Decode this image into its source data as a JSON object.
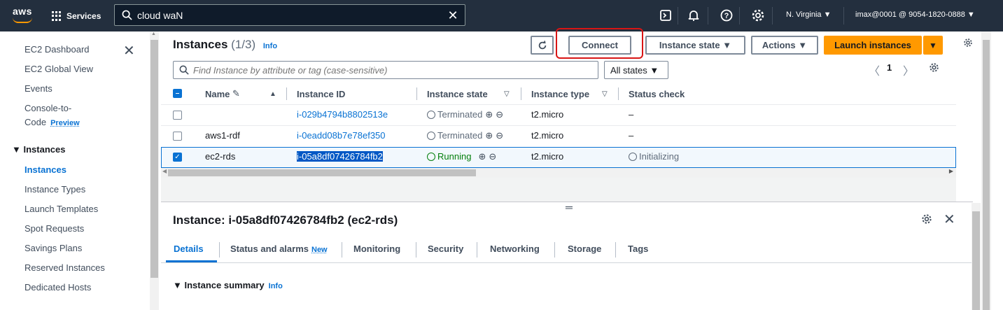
{
  "topbar": {
    "logo": "aws",
    "services": "Services",
    "search_value": "cloud waN",
    "region": "N. Virginia ▼",
    "account": "imax@0001 @ 9054-1820-0888 ▼",
    "icons": [
      "cloudshell-icon",
      "notifications-icon",
      "help-icon",
      "settings-icon"
    ]
  },
  "sidebar": {
    "items": [
      {
        "label": "EC2 Dashboard"
      },
      {
        "label": "EC2 Global View"
      },
      {
        "label": "Events"
      },
      {
        "label": "Console-to-"
      },
      {
        "label": "Code"
      },
      {
        "label": "Instances"
      },
      {
        "label": "Instance Types"
      },
      {
        "label": "Launch Templates"
      },
      {
        "label": "Spot Requests"
      },
      {
        "label": "Savings Plans"
      },
      {
        "label": "Reserved Instances"
      },
      {
        "label": "Dedicated Hosts"
      }
    ],
    "preview": "Preview",
    "section": "▼ Instances"
  },
  "header": {
    "title": "Instances",
    "count": "(1/3)",
    "info": "Info",
    "connect": "Connect",
    "instance_state": "Instance state ▼",
    "actions": "Actions ▼",
    "launch": "Launch instances",
    "launch_dropdown": "▼",
    "filter_placeholder": "Find Instance by attribute or tag (case-sensitive)",
    "states": "All states ▼",
    "page": "1"
  },
  "table": {
    "columns": [
      "Name",
      "Instance ID",
      "Instance state",
      "Instance type",
      "Status check"
    ],
    "rows": [
      {
        "name": "",
        "id": "i-029b4794b8802513e",
        "state": "Terminated",
        "type": "t2.micro",
        "status": "–"
      },
      {
        "name": "aws1-rdf",
        "id": "i-0eadd08b7e78ef350",
        "state": "Terminated",
        "type": "t2.micro",
        "status": "–"
      },
      {
        "name": "ec2-rds",
        "id": "i-05a8df07426784fb2",
        "state": "Running",
        "type": "t2.micro",
        "status": "Initializing"
      }
    ]
  },
  "detail": {
    "title": "Instance: i-05a8df07426784fb2 (ec2-rds)",
    "tabs": [
      "Details",
      "Status and alarms",
      "Monitoring",
      "Security",
      "Networking",
      "Storage",
      "Tags"
    ],
    "new_badge": "New",
    "summary": "▼  Instance summary",
    "summary_info": "Info"
  },
  "colors": {
    "accent": "#0972d3",
    "orange": "#ff9900",
    "topbar": "#232f3e",
    "highlight": "#d91515"
  }
}
